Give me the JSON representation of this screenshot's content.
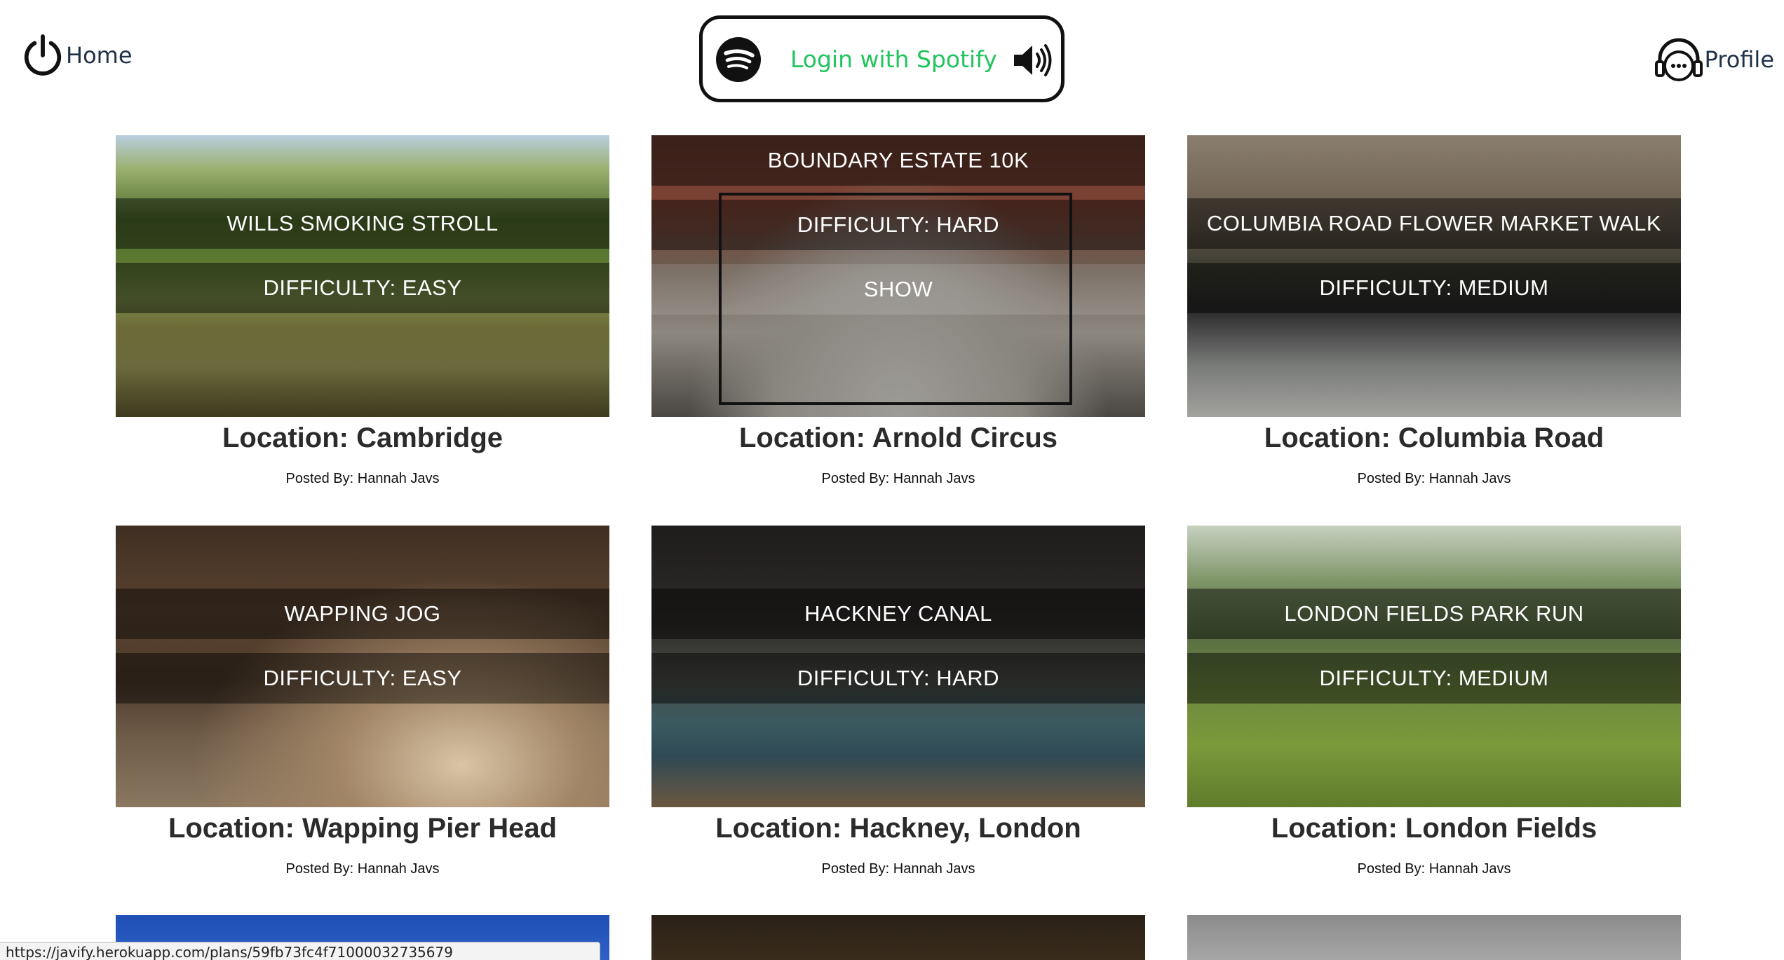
{
  "nav": {
    "home_label": "Home",
    "spotify_label": "Login with Spotify",
    "profile_label": "Profile"
  },
  "colors": {
    "spotify_green": "#21c45d",
    "nav_text": "#1f3146",
    "card_title": "#2b2b2b"
  },
  "cards": [
    {
      "name": "WILLS SMOKING STROLL",
      "difficulty": "DIFFICULTY: EASY",
      "location": "Location: Cambridge",
      "posted_by": "Posted By: Hannah Javs"
    },
    {
      "name": "BOUNDARY ESTATE 10K",
      "difficulty": "DIFFICULTY: HARD",
      "show": "SHOW",
      "location": "Location: Arnold Circus",
      "posted_by": "Posted By: Hannah Javs"
    },
    {
      "name": "COLUMBIA ROAD FLOWER MARKET WALK",
      "difficulty": "DIFFICULTY: MEDIUM",
      "location": "Location: Columbia Road",
      "posted_by": "Posted By: Hannah Javs"
    },
    {
      "name": "WAPPING JOG",
      "difficulty": "DIFFICULTY: EASY",
      "location": "Location: Wapping Pier Head",
      "posted_by": "Posted By: Hannah Javs"
    },
    {
      "name": "HACKNEY CANAL",
      "difficulty": "DIFFICULTY: HARD",
      "location": "Location: Hackney, London",
      "posted_by": "Posted By: Hannah Javs"
    },
    {
      "name": "LONDON FIELDS PARK RUN",
      "difficulty": "DIFFICULTY: MEDIUM",
      "location": "Location: London Fields",
      "posted_by": "Posted By: Hannah Javs"
    }
  ],
  "status_bar": {
    "url": "https://javify.herokuapp.com/plans/59fb73fc4f71000032735679"
  },
  "icons": {
    "home": "power-icon",
    "spotify": "spotify-logo-icon",
    "speaker": "speaker-volume-icon",
    "profile": "headphones-face-icon"
  }
}
